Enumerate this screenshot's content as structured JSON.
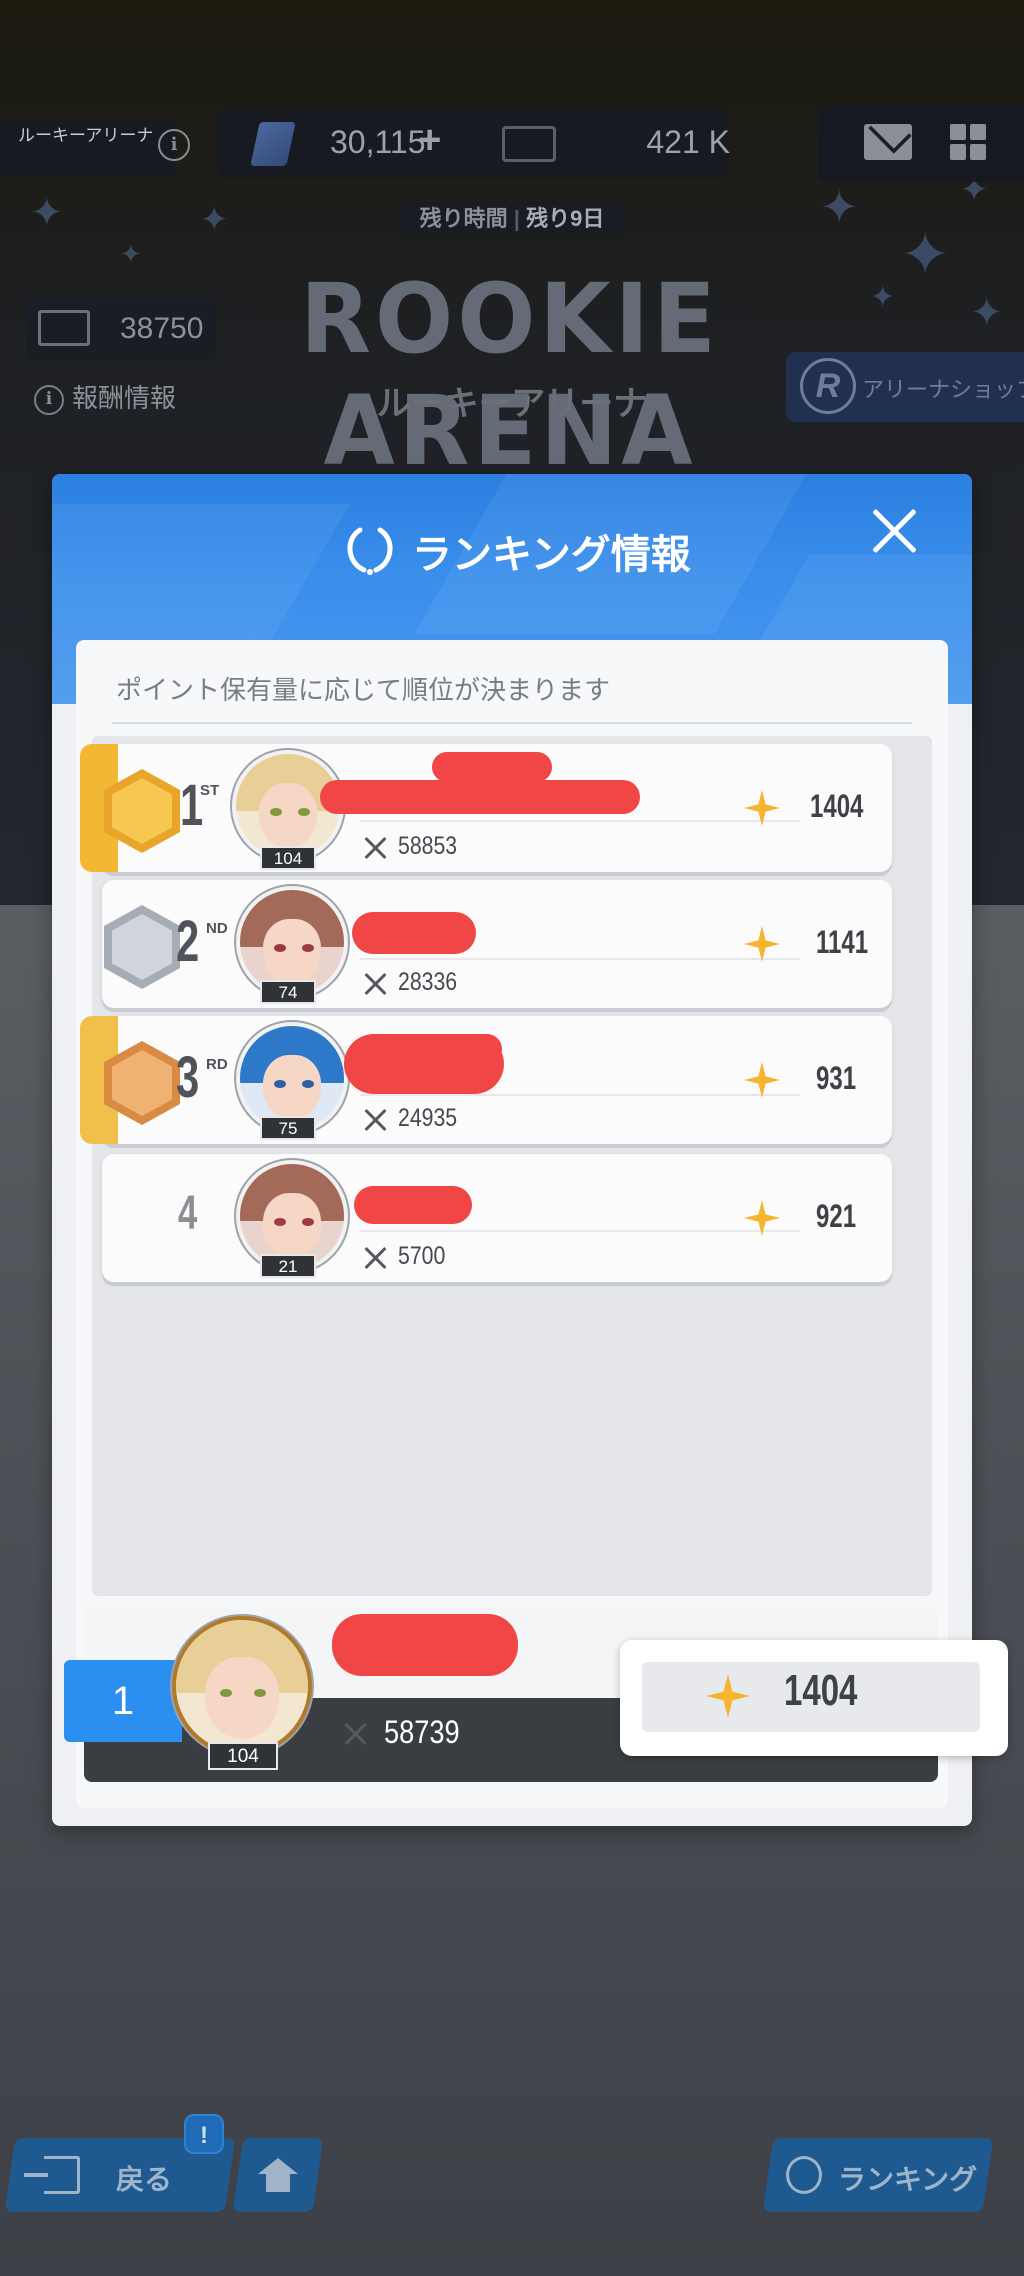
{
  "background": {
    "arena_chip": "ルーキーアリーナ",
    "gems": "30,115",
    "tickets": "421 K",
    "remaining_label": "残り時間",
    "remaining_value": "残り9日",
    "title": "ROOKIE ARENA",
    "subtitle": "ルーキーアリーナ",
    "arena_pass": "38750",
    "reward_info": "報酬情報",
    "shop": "アリーナショップ"
  },
  "modal": {
    "title": "ランキング情報",
    "description": "ポイント保有量に応じて順位が決まります",
    "rows": [
      {
        "rank": "1",
        "suffix": "ST",
        "level": "104",
        "power": "58853",
        "points": "1404",
        "medal": "gold"
      },
      {
        "rank": "2",
        "suffix": "ND",
        "level": "74",
        "power": "28336",
        "points": "1141",
        "medal": "silver"
      },
      {
        "rank": "3",
        "suffix": "RD",
        "level": "75",
        "power": "24935",
        "points": "931",
        "medal": "bronze"
      },
      {
        "rank": "4",
        "suffix": "",
        "level": "21",
        "power": "5700",
        "points": "921",
        "medal": "none"
      }
    ],
    "me": {
      "rank": "1",
      "level": "104",
      "power": "58739",
      "points": "1404"
    }
  },
  "nav": {
    "back": "戻る",
    "badge": "!",
    "ranking": "ランキング"
  },
  "colors": {
    "header_blue": "#2b7fe0",
    "my_rank_blue": "#2a8ff0",
    "gold": "#f2b733",
    "silver": "#b9bec6",
    "bronze": "#e7a463",
    "points_star": "#f5b52e",
    "redaction": "#f04646"
  }
}
